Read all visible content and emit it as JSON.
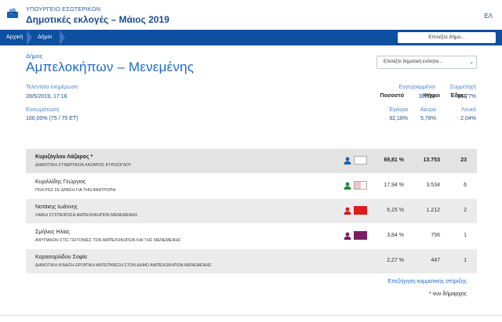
{
  "header": {
    "ministry": "ΥΠΟΥΡΓΕΙΟ ΕΣΩΤΕΡΙΚΩΝ",
    "title": "Δημοτικές εκλογές – Μάιος 2019",
    "language": "ΕΛ",
    "logo_icon": "ballot-box-icon"
  },
  "nav": {
    "breadcrumb": [
      "Αρχική",
      "Δήμοι"
    ],
    "select_municipality": "Επιλέξτε δήμο..."
  },
  "municipality": {
    "kind": "Δήμος",
    "name": "Αμπελοκήπων – Μενεμένης",
    "unit_select_placeholder": "Επιλέξτε δημοτική ενότητα..."
  },
  "stats": {
    "last_update_label": "Τελευταία ενημέρωση",
    "last_update_value": "28/5/2019, 17:16",
    "integration_label": "Ενσωμάτωση",
    "integration_value": "100,00% (75 / 75 ΕΤ)",
    "registered_label": "Εγγεγραμμένοι",
    "registered_value": "38.324",
    "turnout_label": "Συμμετοχή",
    "turnout_value": "55,77%",
    "valid_label": "Έγκυρα",
    "valid_value": "92,18%",
    "invalid_label": "Άκυρα",
    "invalid_value": "5,78%",
    "blank_label": "Λευκά",
    "blank_value": "2,04%"
  },
  "table": {
    "headers": {
      "percent": "Ποσοστό",
      "votes": "Ψήφοι",
      "seats": "Έδρες"
    },
    "rows": [
      {
        "candidate": "Κυριζόγλου Λάζαρος *",
        "party": "ΔΗΜΟΤΙΚΗ ΣΥΝΕΡΓΑΣΙΑ ΛΑΖΑΡΟΣ ΚΥΡΙΖΟΓΛΟΥ",
        "percent": "69,81 %",
        "votes": "13.753",
        "seats": "23",
        "icon_color": "#1f5fb0",
        "swatch_color": "#ffffff",
        "swatch_split": false
      },
      {
        "candidate": "Κυριλλίδης Γεώργιος",
        "party": "ΠΟΛΙΤΕΣ ΣΕ ΔΡΑΣΗ ΓΙΑ ΤΗΝ ΑΝΑΤΡΟΠΗ",
        "percent": "17,94 %",
        "votes": "3.534",
        "seats": "6",
        "icon_color": "#1f8a3a",
        "swatch_color": "#f3c5c5",
        "swatch_split": true
      },
      {
        "candidate": "Νοτάκης Ιωάννης",
        "party": "ΛΑΪΚΗ ΣΥΣΠΕΙΡΩΣΗ ΑΜΠΕΛΟΚΗΠΩΝ ΜΕΝΕΜΕΝΗΣ",
        "percent": "6,15 %",
        "votes": "1.212",
        "seats": "2",
        "icon_color": "#d21c1c",
        "swatch_color": "#e01b1b",
        "swatch_split": false
      },
      {
        "candidate": "Σμήλιος Ηλίας",
        "party": "ΑΝΥΠΑΚΟΗ ΣΤΙΣ ΓΕΙΤΟΝΙΕΣ ΤΩΝ ΑΜΠΕΛΟΚΗΠΩΝ ΚΑΙ ΤΗΣ ΜΕΝΕΜΕΝΗΣ",
        "percent": "3,84 %",
        "votes": "756",
        "seats": "1",
        "icon_color": "#7a1f66",
        "swatch_color": "#7a1f66",
        "swatch_split": false
      },
      {
        "candidate": "Καρασαρλίδου Σοφία",
        "party": "ΔΗΜΟΤΙΚΗ ΚΙΝΗΣΗ ΕΡΓΑΤΙΚΗ ΑΝΤΕΠΙΘΕΣΗ ΣΤΟΝ ΔΗΜΟ ΑΜΠΕΛΟΚΗΠΩΝ-ΜΕΝΕΜΕΝΗΣ",
        "percent": "2,27 %",
        "votes": "447",
        "seats": "1",
        "icon_color": "",
        "swatch_color": "",
        "swatch_split": false
      }
    ]
  },
  "footer": {
    "support_link": "Επεξήγηση κομματικής στήριξης",
    "footnote": "* νυν δήμαρχος"
  }
}
